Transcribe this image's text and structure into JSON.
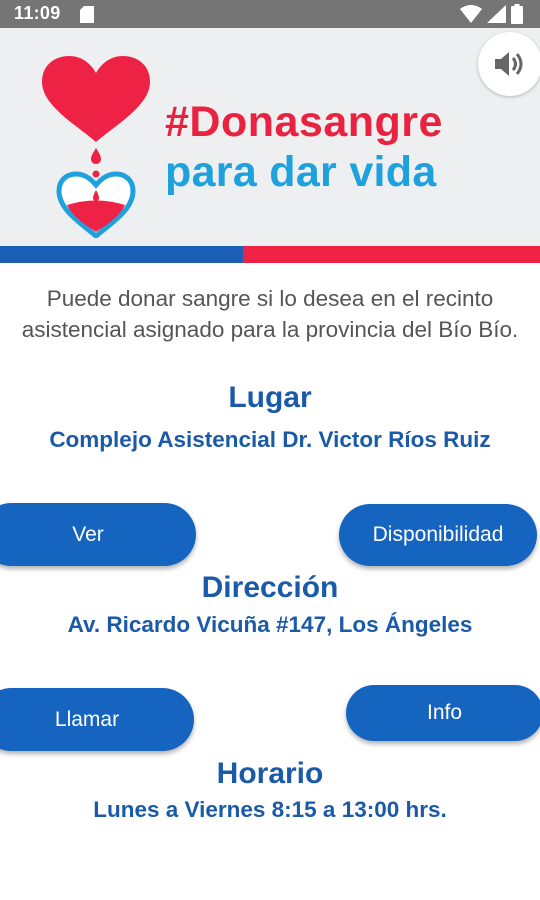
{
  "status_bar": {
    "time": "11:09",
    "icons": [
      "sd-card-icon",
      "wifi-icon",
      "signal-icon",
      "battery-icon"
    ]
  },
  "banner": {
    "line1": "#Donasangre",
    "line2": "para dar vida",
    "logo_icon": "heart-blood-drop-icon",
    "sound_icon": "volume-icon",
    "colors": {
      "red": "#e8223f",
      "blue": "#1ea1dc",
      "background": "#edeff1"
    }
  },
  "flag_colors": {
    "blue": "#1a5fb4",
    "red": "#ee2245"
  },
  "intro_text": "Puede donar sangre si lo desea en el recinto asistencial asignado para la provincia del Bío Bío.",
  "lugar": {
    "title": "Lugar",
    "value": "Complejo Asistencial Dr. Victor Ríos Ruiz"
  },
  "buttons": {
    "ver": "Ver",
    "disponibilidad": "Disponibilidad",
    "llamar": "Llamar",
    "info": "Info"
  },
  "direccion": {
    "title": "Dirección",
    "value": "Av. Ricardo Vicuña #147, Los Ángeles"
  },
  "horario": {
    "title": "Horario",
    "value": "Lunes a Viernes 8:15 a 13:00 hrs."
  },
  "theme": {
    "accent": "#1565c0",
    "text_blue": "#1a5aa8",
    "body_text": "#555555"
  }
}
